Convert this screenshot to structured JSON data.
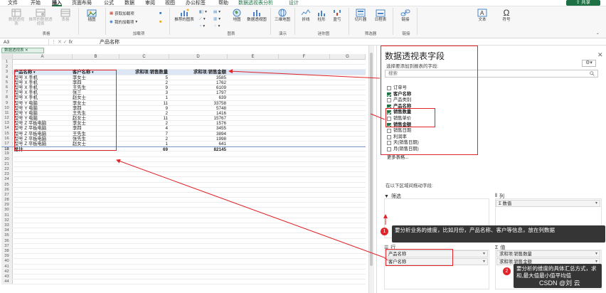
{
  "menu": {
    "items": [
      "文件",
      "开始",
      "插入",
      "页面布局",
      "公式",
      "数据",
      "审阅",
      "视图",
      "办公标签",
      "帮助",
      "数据透视表分析",
      "设计"
    ],
    "active": "插入",
    "share": "共享"
  },
  "ribbon": {
    "groups": {
      "tables": "表格",
      "illustrations": "",
      "addins": "加载项",
      "charts": "图表",
      "tours": "演示",
      "sparklines": "迷你图",
      "filters": "筛选器",
      "links": "链接"
    },
    "buttons": {
      "pivot": "数据透视表",
      "recommended_pivot": "推荐的数据透视表",
      "table": "表格",
      "illustrations": "插图",
      "get_addins": "获取加载项",
      "my_addins": "我的加载项",
      "recommended_charts": "推荐的图表",
      "map": "地图",
      "pivot_chart": "数据透视图",
      "map3d": "三维地图",
      "line": "折线",
      "column": "柱形",
      "winloss": "盈亏",
      "slicer": "切片器",
      "timeline": "日程表",
      "link": "链接",
      "text": "文本",
      "symbol": "符号"
    }
  },
  "formula_bar": {
    "name_box": "A3",
    "fx": "fx",
    "content": "产品名称"
  },
  "sheet_tab": "数据透视表",
  "grid": {
    "col_headers": [
      "A",
      "B",
      "C",
      "D",
      "E",
      "F",
      "G"
    ],
    "header_row": {
      "a": "产品名称",
      "b": "客户名称",
      "c": "求和项:销售数量",
      "d": "求和项:销售金额"
    },
    "rows": [
      {
        "n": "4",
        "a": "型号 X 手机",
        "b": "李女士",
        "c": "5",
        "d": "3585"
      },
      {
        "n": "5",
        "a": "型号 X 手机",
        "b": "李四",
        "c": "2",
        "d": "1762"
      },
      {
        "n": "6",
        "a": "型号 X 手机",
        "b": "王先生",
        "c": "9",
        "d": "6109"
      },
      {
        "n": "7",
        "a": "型号 X 手机",
        "b": "张三",
        "c": "3",
        "d": "1797"
      },
      {
        "n": "8",
        "a": "型号 X 手机",
        "b": "赵女士",
        "c": "1",
        "d": "639"
      },
      {
        "n": "9",
        "a": "型号 Y 电脑",
        "b": "李女士",
        "c": "11",
        "d": "33758"
      },
      {
        "n": "10",
        "a": "型号 Y 电脑",
        "b": "李四",
        "c": "9",
        "d": "5748"
      },
      {
        "n": "11",
        "a": "型号 Y 电脑",
        "b": "王先生",
        "c": "2",
        "d": "1416"
      },
      {
        "n": "12",
        "a": "型号 Y 电脑",
        "b": "赵女士",
        "c": "11",
        "d": "15767"
      },
      {
        "n": "13",
        "a": "型号 Z 平板电脑",
        "b": "李女士",
        "c": "2",
        "d": "1576"
      },
      {
        "n": "14",
        "a": "型号 Z 平板电脑",
        "b": "李四",
        "c": "4",
        "d": "3455"
      },
      {
        "n": "15",
        "a": "型号 Z 平板电脑",
        "b": "王先生",
        "c": "7",
        "d": "3894"
      },
      {
        "n": "16",
        "a": "型号 Z 平板电脑",
        "b": "张先生",
        "c": "2",
        "d": "1998"
      },
      {
        "n": "17",
        "a": "型号 Z 平板电脑",
        "b": "赵女士",
        "c": "1",
        "d": "641"
      }
    ],
    "total_row": {
      "n": "18",
      "a": "总计",
      "c": "69",
      "d": "82145"
    },
    "empty_rows": [
      "19",
      "20",
      "21",
      "22",
      "23",
      "24",
      "25",
      "26",
      "27",
      "28",
      "29",
      "30",
      "31",
      "32",
      "33",
      "34",
      "35",
      "36",
      "37",
      "38",
      "39",
      "40",
      "41",
      "42",
      "43",
      "44"
    ]
  },
  "pane": {
    "title": "数据透视表字段",
    "subtitle": "选择要添加到报表的字段:",
    "search_placeholder": "搜索",
    "fields": [
      {
        "label": "订单号",
        "checked": false
      },
      {
        "label": "客户名称",
        "checked": true
      },
      {
        "label": "产品类别",
        "checked": false
      },
      {
        "label": "产品名称",
        "checked": true
      },
      {
        "label": "销售数量",
        "checked": true
      },
      {
        "label": "销售单价",
        "checked": false
      },
      {
        "label": "销售金额",
        "checked": true
      },
      {
        "label": "销售日期",
        "checked": false
      },
      {
        "label": "利润率",
        "checked": false
      },
      {
        "label": "天(销售日期)",
        "checked": false
      },
      {
        "label": "月(销售日期)",
        "checked": false
      }
    ],
    "more_tables": "更多表格...",
    "drag_label": "在以下区域间拖动字段:",
    "zones": {
      "filters": "筛选",
      "columns": "列",
      "rows": "行",
      "values": "值"
    },
    "column_chip": "Σ 数值",
    "row_chips": [
      "产品名称",
      "客户名称"
    ],
    "value_chips": [
      "求和项:销售数量",
      "求和项:销售金额"
    ]
  },
  "callouts": {
    "one": {
      "num": "1",
      "text": "要分析业务的维度，比如月份，产品名称、客户等信息，放在列数据"
    },
    "two": {
      "num": "2",
      "text": "要分析的维度的具体汇总方式，求和,最大值最小值平均值"
    }
  },
  "watermark": "CSDN @刘 云",
  "colors": {
    "accent": "#1e7145",
    "highlight": "#e0242a",
    "pivot_header": "#dce6f5"
  }
}
